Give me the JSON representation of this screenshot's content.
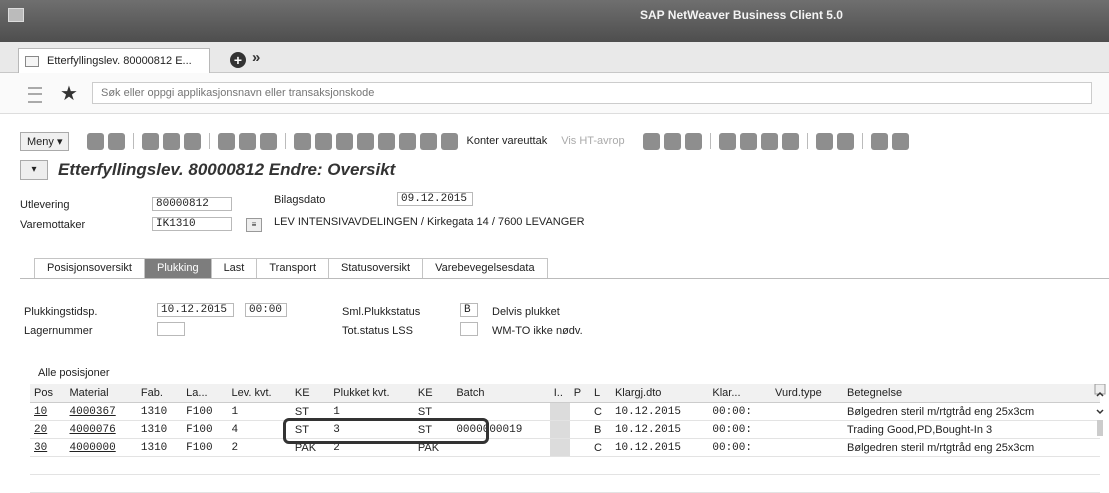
{
  "window": {
    "title": "SAP NetWeaver Business Client 5.0"
  },
  "tab": {
    "label": "Etterfyllingslev. 80000812 E..."
  },
  "search": {
    "placeholder": "Søk eller oppgi applikasjonsnavn eller transaksjonskode"
  },
  "toolbar": {
    "menu": "Meny",
    "konter": "Konter vareuttak",
    "vis": "Vis HT-avrop"
  },
  "page": {
    "title": "Etterfyllingslev. 80000812 Endre: Oversikt"
  },
  "header": {
    "utlevering_label": "Utlevering",
    "utlevering_value": "80000812",
    "bilagsdato_label": "Bilagsdato",
    "bilagsdato_value": "09.12.2015",
    "varemottaker_label": "Varemottaker",
    "varemottaker_value": "IK1310",
    "address": "LEV INTENSIVAVDELINGEN / Kirkegata 14 / 7600 LEVANGER"
  },
  "subtabs": [
    "Posisjonsoversikt",
    "Plukking",
    "Last",
    "Transport",
    "Statusoversikt",
    "Varebevegelsesdata"
  ],
  "picking": {
    "tidsp_label": "Plukkingstidsp.",
    "tidsp_date": "10.12.2015",
    "tidsp_time": "00:00",
    "sml_label": "Sml.Plukkstatus",
    "sml_code": "B",
    "sml_text": "Delvis plukket",
    "lager_label": "Lagernummer",
    "tot_label": "Tot.status LSS",
    "tot_text": "WM-TO ikke nødv."
  },
  "grid": {
    "title": "Alle posisjoner",
    "columns": [
      "Pos",
      "Material",
      "Fab.",
      "La...",
      "Lev. kvt.",
      "KE",
      "Plukket kvt.",
      "KE",
      "Batch",
      "I..",
      "P",
      "L",
      "Klargj.dto",
      "Klar...",
      "Vurd.type",
      "Betegnelse"
    ],
    "rows": [
      {
        "pos": "10",
        "material": "4000367",
        "fab": "1310",
        "la": "F100",
        "lev": "1",
        "ke1": "ST",
        "plukket": "1",
        "ke2": "ST",
        "batch": "",
        "p": "",
        "l": "C",
        "dato": "10.12.2015",
        "klar": "00:00:",
        "vurd": "",
        "bet": "Bølgedren steril m/rtgtråd eng 25x3cm"
      },
      {
        "pos": "20",
        "material": "4000076",
        "fab": "1310",
        "la": "F100",
        "lev": "4",
        "ke1": "ST",
        "plukket": "3",
        "ke2": "ST",
        "batch": "0000000019",
        "p": "",
        "l": "B",
        "dato": "10.12.2015",
        "klar": "00:00:",
        "vurd": "",
        "bet": "Trading Good,PD,Bought-In 3"
      },
      {
        "pos": "30",
        "material": "4000000",
        "fab": "1310",
        "la": "F100",
        "lev": "2",
        "ke1": "PAK",
        "plukket": "2",
        "ke2": "PAK",
        "batch": "",
        "p": "",
        "l": "C",
        "dato": "10.12.2015",
        "klar": "00:00:",
        "vurd": "",
        "bet": "Bølgedren steril m/rtgtråd eng 25x3cm"
      }
    ]
  },
  "colors": {
    "titlebar": "#555555",
    "active_tab": "#7d7d7d",
    "highlight": "#333333"
  }
}
